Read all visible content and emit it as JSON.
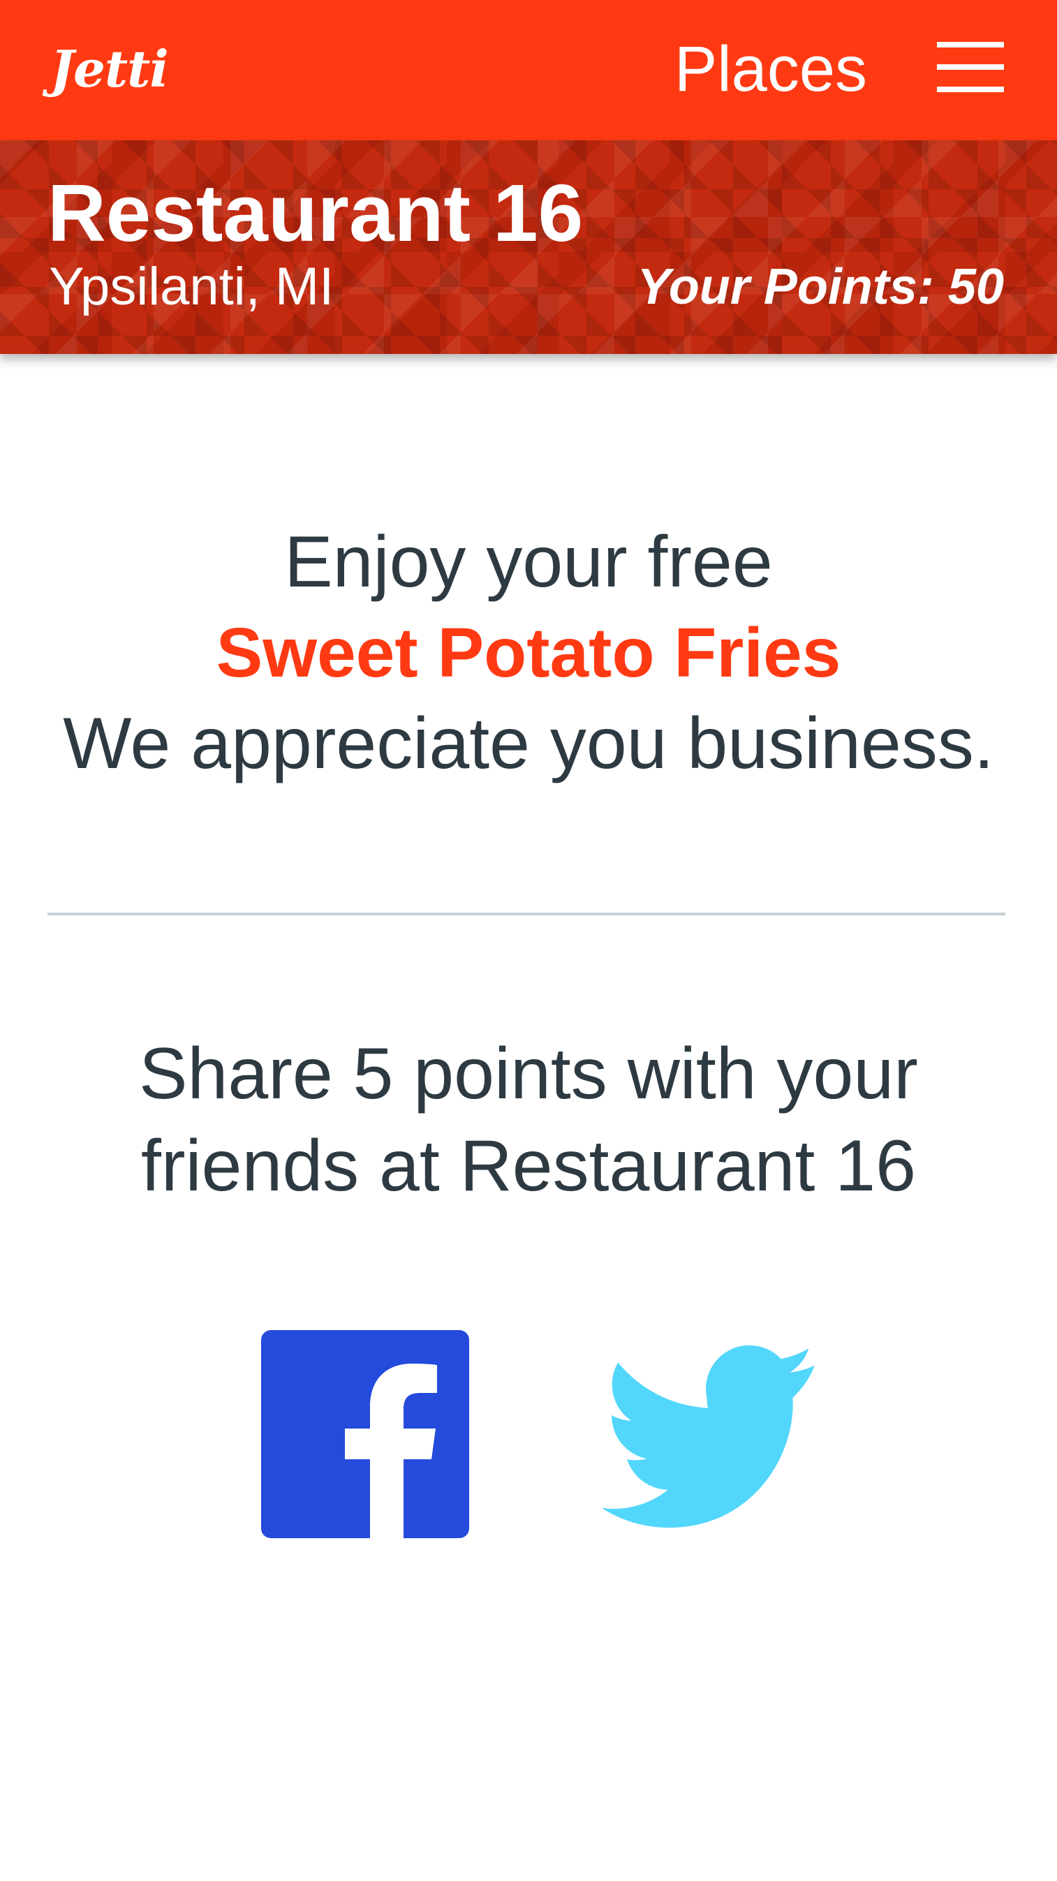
{
  "header": {
    "logo_text": "Jetti",
    "nav_label": "Places"
  },
  "restaurant": {
    "name": "Restaurant 16",
    "location": "Ypsilanti, MI",
    "points_text": "Your Points: 50"
  },
  "reward": {
    "line1": "Enjoy your free",
    "item": "Sweet Potato Fries",
    "line3": "We appreciate you business."
  },
  "share": {
    "line1": "Share 5 points with your",
    "line2": "friends at Restaurant 16"
  },
  "icons": {
    "menu": "hamburger-menu-icon",
    "facebook": "facebook-icon",
    "twitter": "twitter-icon"
  },
  "colors": {
    "brand": "#ff3a12",
    "banner": "#c42a0f",
    "text": "#2e3a42",
    "facebook": "#244bdc",
    "twitter": "#52d6fc"
  }
}
